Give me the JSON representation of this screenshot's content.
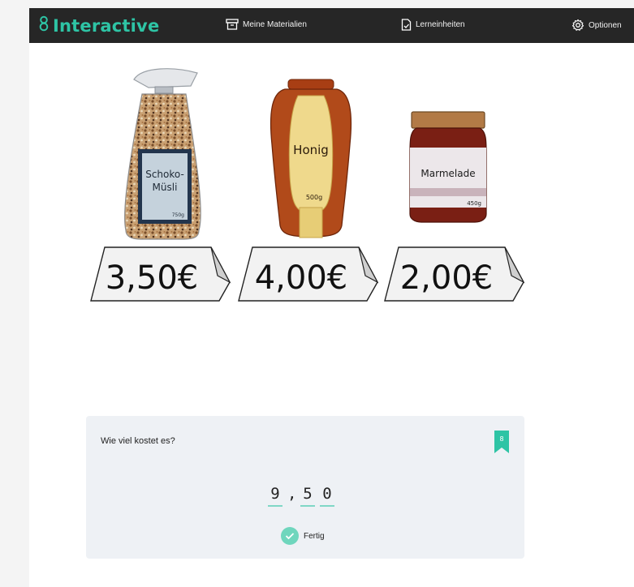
{
  "brand": {
    "name": "Interactive",
    "icon": "figure-eight-logo-icon",
    "color": "#2ec4a5"
  },
  "nav": {
    "materials": {
      "label": "Meine Materialien",
      "icon": "archive-box-icon"
    },
    "units": {
      "label": "Lerneinheiten",
      "icon": "document-check-icon"
    },
    "options": {
      "label": "Optionen",
      "icon": "gear-icon"
    }
  },
  "products": [
    {
      "label_lines": [
        "Schoko-",
        "Müsli"
      ],
      "weight": "750g",
      "price": "3,50€"
    },
    {
      "label_lines": [
        "Honig"
      ],
      "weight": "500g",
      "price": "4,00€"
    },
    {
      "label_lines": [
        "Marmelade"
      ],
      "weight": "450g",
      "price": "2,00€"
    }
  ],
  "task": {
    "question": "Wie viel kostet es?",
    "bookmark_number": "8",
    "answer_digits": [
      "9",
      "5",
      "0"
    ],
    "decimal_separator": ",",
    "done_label": "Fertig",
    "accent_color": "#2ec4a5"
  }
}
